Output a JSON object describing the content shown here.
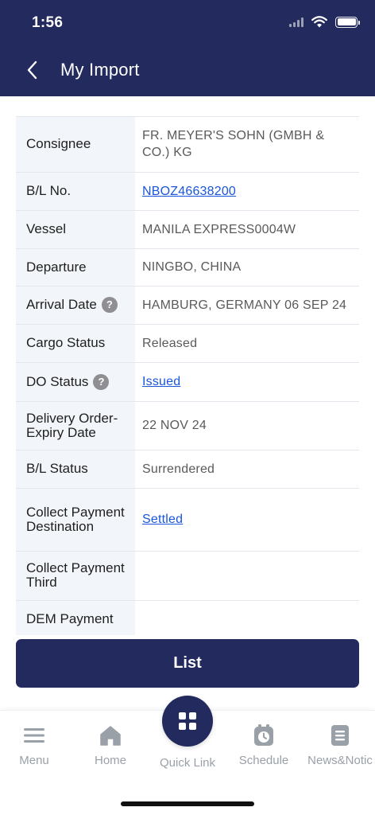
{
  "status_bar": {
    "time": "1:56"
  },
  "header": {
    "title": "My Import"
  },
  "details": [
    {
      "label": "Consignee",
      "value": "FR. MEYER'S SOHN (GMBH & CO.) KG",
      "link": false,
      "help": false
    },
    {
      "label": "B/L No.",
      "value": "NBOZ46638200",
      "link": true,
      "help": false
    },
    {
      "label": "Vessel",
      "value": "MANILA EXPRESS0004W",
      "link": false,
      "help": false
    },
    {
      "label": "Departure",
      "value": "NINGBO, CHINA",
      "link": false,
      "help": false
    },
    {
      "label": "Arrival Date",
      "value": "HAMBURG, GERMANY 06 SEP 24",
      "link": false,
      "help": true
    },
    {
      "label": "Cargo Status",
      "value": "Released",
      "link": false,
      "help": false
    },
    {
      "label": "DO Status",
      "value": "Issued",
      "link": true,
      "help": true
    },
    {
      "label": "Delivery Order-Expiry Date",
      "value": "22 NOV 24",
      "link": false,
      "help": false
    },
    {
      "label": "B/L Status",
      "value": "Surrendered",
      "link": false,
      "help": false
    },
    {
      "label": "Collect Payment Destination",
      "value": "Settled",
      "link": true,
      "help": false
    },
    {
      "label": "Collect Payment Third",
      "value": "",
      "link": false,
      "help": false
    },
    {
      "label": "DEM Payment",
      "value": "",
      "link": false,
      "help": false
    }
  ],
  "help_glyph": "?",
  "list_button": {
    "label": "List"
  },
  "tabs": {
    "menu": "Menu",
    "home": "Home",
    "quick_link": "Quick Link",
    "schedule": "Schedule",
    "news": "News&Notic"
  },
  "icons": {
    "back": "chevron-left-icon",
    "menu": "hamburger-icon",
    "home": "house-icon",
    "quick_link": "grid-icon",
    "schedule": "alarm-clock-icon",
    "news": "document-icon"
  },
  "colors": {
    "primary": "#222a5e",
    "link": "#1a56db",
    "label_bg": "#f2f5f9",
    "tab_inactive": "#9aa0a8"
  }
}
